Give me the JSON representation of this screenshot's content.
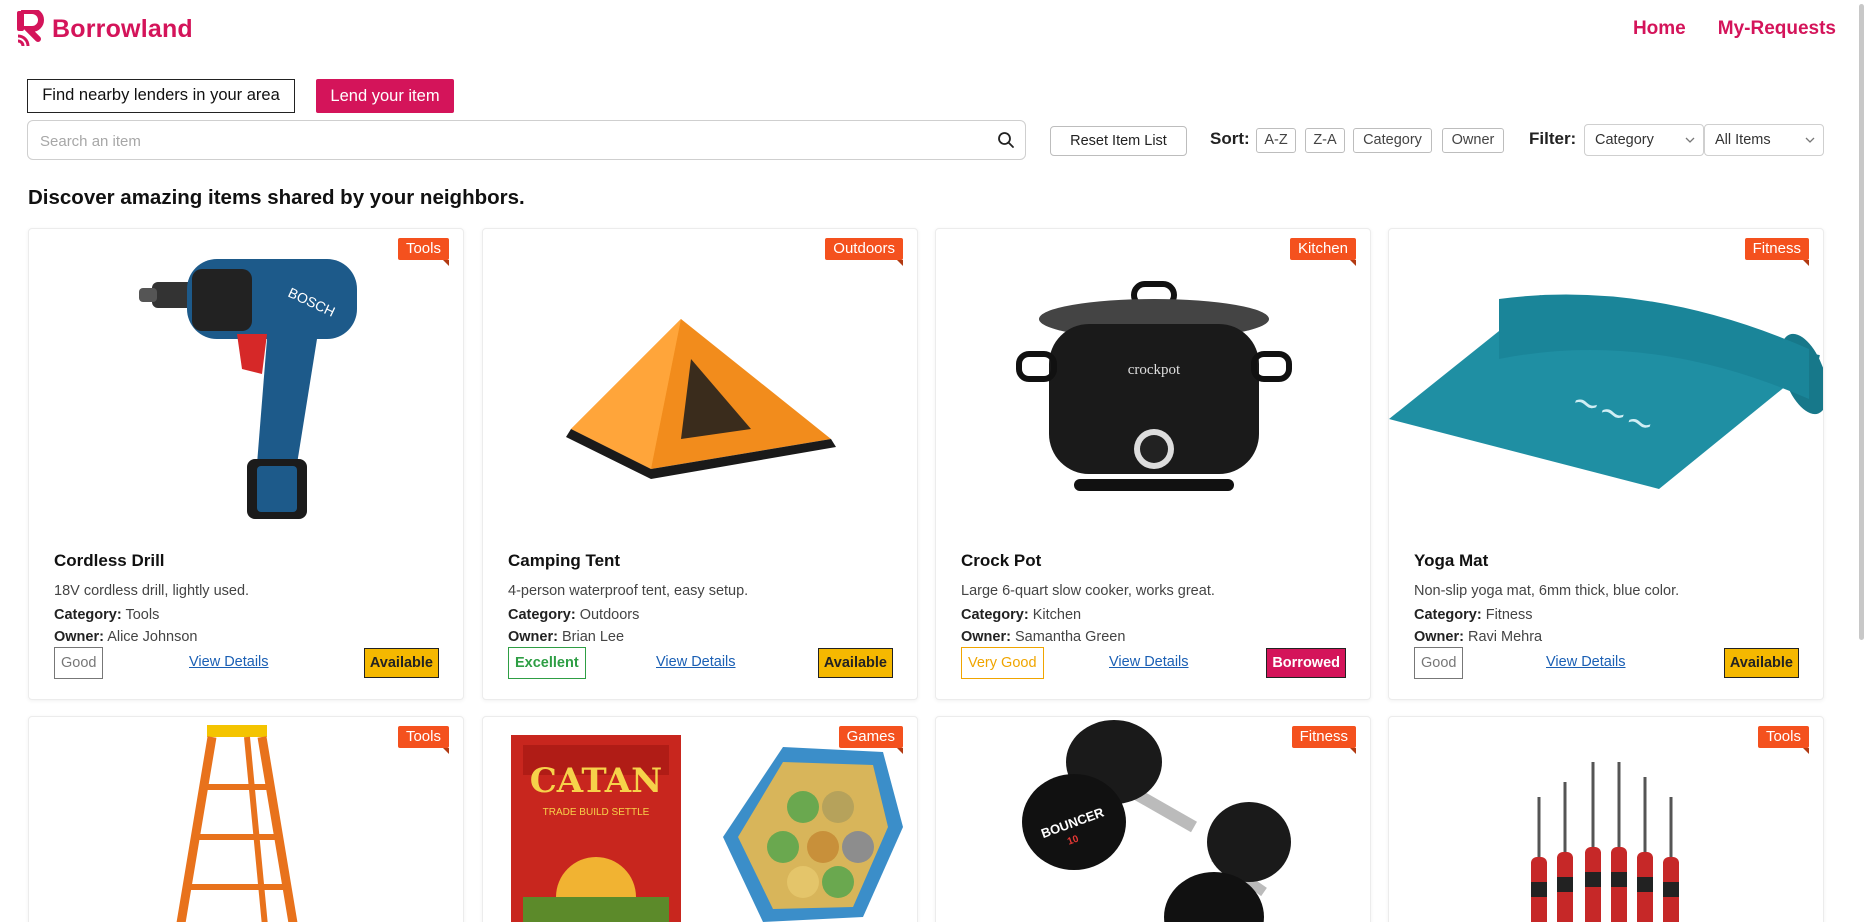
{
  "brand": {
    "name": "Borrowland",
    "color": "#d4145a"
  },
  "nav": {
    "home": "Home",
    "requests": "My-Requests"
  },
  "actions": {
    "find": "Find nearby lenders in your area",
    "lend": "Lend your item"
  },
  "search": {
    "placeholder": "Search an item",
    "value": ""
  },
  "toolbar": {
    "reset": "Reset Item List",
    "sort_label": "Sort:",
    "sort_options": [
      "A-Z",
      "Z-A",
      "Category",
      "Owner"
    ],
    "filter_label": "Filter:",
    "filter_category": "Category",
    "filter_items": "All Items"
  },
  "heading": "Discover amazing items shared by your neighbors.",
  "labels": {
    "category": "Category:",
    "owner": "Owner:",
    "view": "View Details"
  },
  "items": [
    {
      "name": "Cordless Drill",
      "tag": "Tools",
      "desc": "18V cordless drill, lightly used.",
      "category": "Tools",
      "owner": "Alice Johnson",
      "condition": "Good",
      "status": "Available"
    },
    {
      "name": "Camping Tent",
      "tag": "Outdoors",
      "desc": "4-person waterproof tent, easy setup.",
      "category": "Outdoors",
      "owner": "Brian Lee",
      "condition": "Excellent",
      "status": "Available"
    },
    {
      "name": "Crock Pot",
      "tag": "Kitchen",
      "desc": "Large 6-quart slow cooker, works great.",
      "category": "Kitchen",
      "owner": "Samantha Green",
      "condition": "Very Good",
      "status": "Borrowed"
    },
    {
      "name": "Yoga Mat",
      "tag": "Fitness",
      "desc": "Non-slip yoga mat, 6mm thick, blue color.",
      "category": "Fitness",
      "owner": "Ravi Mehra",
      "condition": "Good",
      "status": "Available"
    },
    {
      "tag": "Tools"
    },
    {
      "tag": "Games"
    },
    {
      "tag": "Fitness"
    },
    {
      "tag": "Tools"
    }
  ],
  "image_text": {
    "drill": "BOSCH",
    "crockpot": "crockpot",
    "catan": "CATAN",
    "catan_sub": "TRADE BUILD SETTLE",
    "dumbbell": "BOUNCER",
    "dumbbell_weight": "10"
  },
  "colors": {
    "accent": "#d4145a",
    "tag": "#f4511e",
    "available": "#f5b800",
    "borrowed": "#d4145a",
    "cond_good": "#777777",
    "cond_excellent": "#2e9e44",
    "cond_verygood": "#f0a500"
  }
}
